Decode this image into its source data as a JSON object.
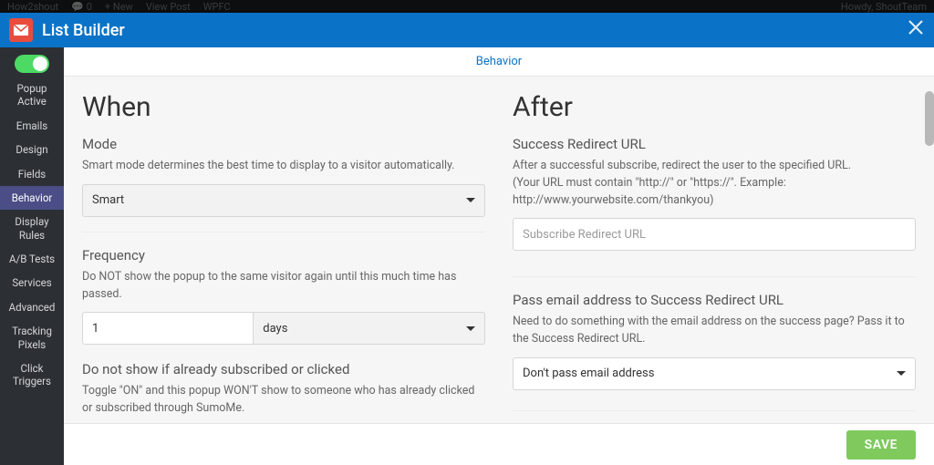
{
  "wp_bar": {
    "site": "How2shout",
    "comments": "0",
    "new": "New",
    "view": "View Post",
    "wpfc": "WPFC",
    "greeting": "Howdy, ShoutTeam"
  },
  "modal": {
    "title": "List Builder",
    "tab": "Behavior",
    "save": "SAVE"
  },
  "sidebar": {
    "toggle_label": "Popup Active",
    "items": [
      "Emails",
      "Design",
      "Fields",
      "Behavior",
      "Display Rules",
      "A/B Tests",
      "Services",
      "Advanced",
      "Tracking Pixels",
      "Click Triggers"
    ],
    "active_index": 3
  },
  "left": {
    "heading": "When",
    "mode_label": "Mode",
    "mode_help": "Smart mode determines the best time to display to a visitor automatically.",
    "mode_value": "Smart",
    "freq_label": "Frequency",
    "freq_help": "Do NOT show the popup to the same visitor again until this much time has passed.",
    "freq_value": "1",
    "freq_unit": "days",
    "noshow_label": "Do not show if already subscribed or clicked",
    "noshow_help": "Toggle \"ON\" and this popup WON'T show to someone who has already clicked or subscribed through SumoMe."
  },
  "right": {
    "heading": "After",
    "redir_label": "Success Redirect URL",
    "redir_help1": "After a successful subscribe, redirect the user to the specified URL.",
    "redir_help2": "(Your URL must contain \"http://\" or \"https://\". Example: http://www.yourwebsite.com/thankyou)",
    "redir_placeholder": "Subscribe Redirect URL",
    "pass_label": "Pass email address to Success Redirect URL",
    "pass_help": "Need to do something with the email address on the success page? Pass it to the Success Redirect URL.",
    "pass_value": "Don't pass email address"
  }
}
